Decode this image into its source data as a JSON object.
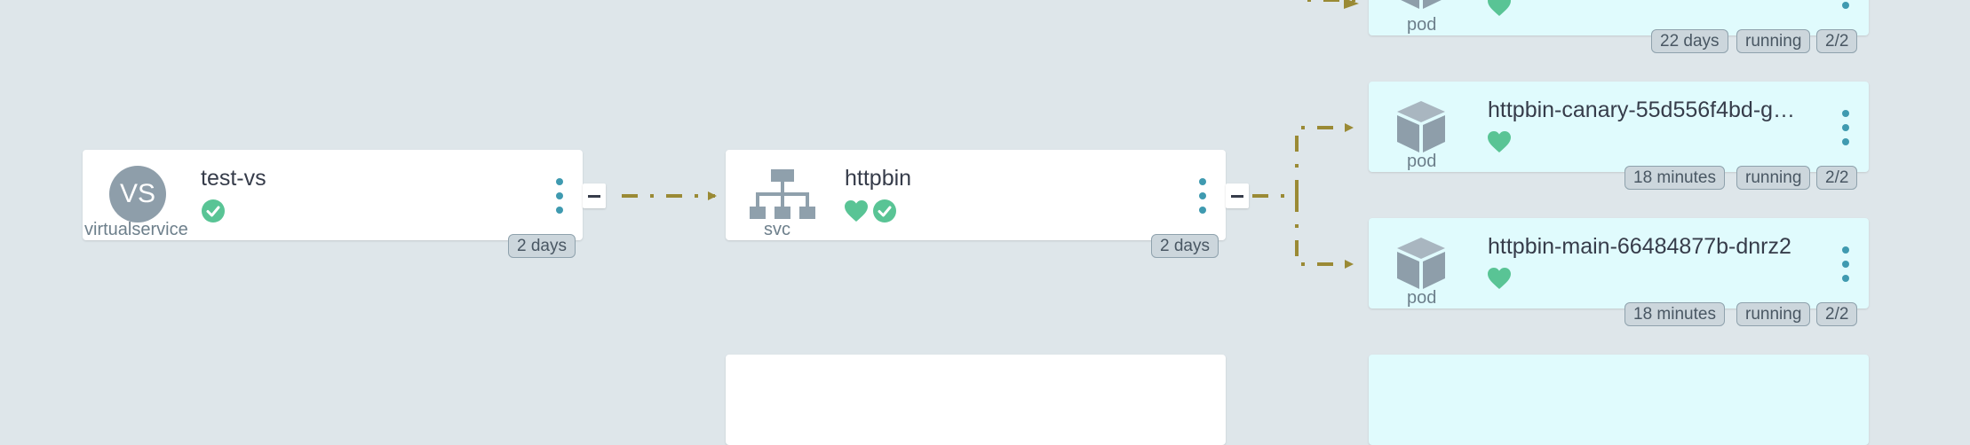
{
  "colors": {
    "background": "#dee6ea",
    "node_background": "#ffffff",
    "pod_background": "#e0fbfd",
    "edge": "#9a8a35",
    "healthy": "#59c495",
    "menu": "#3f9ab0",
    "badge_background": "#ccd6dc",
    "badge_border": "#8fa2ad"
  },
  "nodes": {
    "virtualservice": {
      "avatar_text": "VS",
      "title": "test-vs",
      "kind": "virtualservice",
      "age": "2 days",
      "status_icons": [
        "check-circle-icon"
      ]
    },
    "service": {
      "title": "httpbin",
      "kind": "svc",
      "age": "2 days",
      "icon": "network-hierarchy-icon",
      "status_icons": [
        "heart-icon",
        "check-circle-icon"
      ]
    },
    "pods": [
      {
        "title": "",
        "kind": "pod",
        "age": "22 days",
        "status": "running",
        "ready": "2/2",
        "icon": "cube-icon",
        "status_icons": [
          "heart-icon"
        ]
      },
      {
        "title": "httpbin-canary-55d556f4bd-g…",
        "kind": "pod",
        "age": "18 minutes",
        "status": "running",
        "ready": "2/2",
        "icon": "cube-icon",
        "status_icons": [
          "heart-icon"
        ]
      },
      {
        "title": "httpbin-main-66484877b-dnrz2",
        "kind": "pod",
        "age": "18 minutes",
        "status": "running",
        "ready": "2/2",
        "icon": "cube-icon",
        "status_icons": [
          "heart-icon"
        ]
      }
    ]
  }
}
